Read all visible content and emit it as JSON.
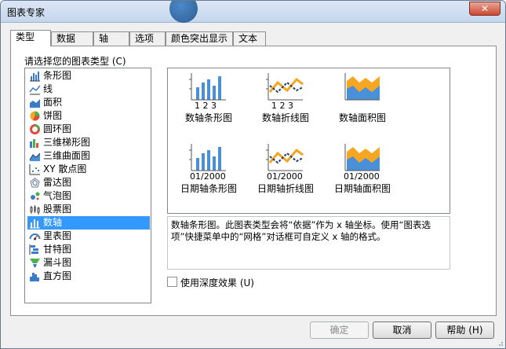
{
  "window": {
    "title": "图表专家",
    "close_label": "✕"
  },
  "tabs": [
    {
      "label": "类型",
      "active": true
    },
    {
      "label": "数据"
    },
    {
      "label": "轴"
    },
    {
      "label": "选项"
    },
    {
      "label": "颜色突出显示"
    },
    {
      "label": "文本"
    }
  ],
  "chart_type": {
    "prompt": "请选择您的图表类型 (C)",
    "items": [
      {
        "label": "条形图",
        "icon": "bar-chart-icon"
      },
      {
        "label": "线",
        "icon": "line-chart-icon"
      },
      {
        "label": "面积",
        "icon": "area-chart-icon"
      },
      {
        "label": "饼图",
        "icon": "pie-chart-icon"
      },
      {
        "label": "圆环图",
        "icon": "donut-chart-icon"
      },
      {
        "label": "三维梯形图",
        "icon": "3d-step-chart-icon"
      },
      {
        "label": "三维曲面图",
        "icon": "3d-surface-chart-icon"
      },
      {
        "label": "XY 散点图",
        "icon": "scatter-chart-icon"
      },
      {
        "label": "雷达图",
        "icon": "radar-chart-icon"
      },
      {
        "label": "气泡图",
        "icon": "bubble-chart-icon"
      },
      {
        "label": "股票图",
        "icon": "stock-chart-icon"
      },
      {
        "label": "数轴",
        "icon": "numeric-axis-icon",
        "selected": true
      },
      {
        "label": "里表图",
        "icon": "gauge-chart-icon"
      },
      {
        "label": "甘特图",
        "icon": "gantt-chart-icon"
      },
      {
        "label": "漏斗图",
        "icon": "funnel-chart-icon"
      },
      {
        "label": "直方图",
        "icon": "histogram-icon"
      }
    ]
  },
  "subtypes": [
    {
      "label": "数轴条形图",
      "kind": "bar",
      "axis_text": "1 2 3"
    },
    {
      "label": "数轴折线图",
      "kind": "line",
      "axis_text": "1 2 3"
    },
    {
      "label": "数轴面积图",
      "kind": "area",
      "axis_text": ""
    },
    {
      "label": "日期轴条形图",
      "kind": "bar",
      "axis_text": "01/2000"
    },
    {
      "label": "日期轴折线图",
      "kind": "line",
      "axis_text": "01/2000"
    },
    {
      "label": "日期轴面积图",
      "kind": "area",
      "axis_text": "01/2000"
    }
  ],
  "description": "数轴条形图。此图表类型会将“依据”作为 x 轴坐标。使用“图表选项”快捷菜单中的“网格”对话框可自定义 x 轴的格式。",
  "depth_effect": {
    "label": "使用深度效果 (U)",
    "checked": false
  },
  "buttons": {
    "ok": "确定",
    "cancel": "取消",
    "help": "帮助 (H)"
  },
  "colors": {
    "selection": "#3399ff",
    "bar_blue": "#4a90d9",
    "line_orange": "#f5a623",
    "line_dark": "#1f3b5c"
  }
}
